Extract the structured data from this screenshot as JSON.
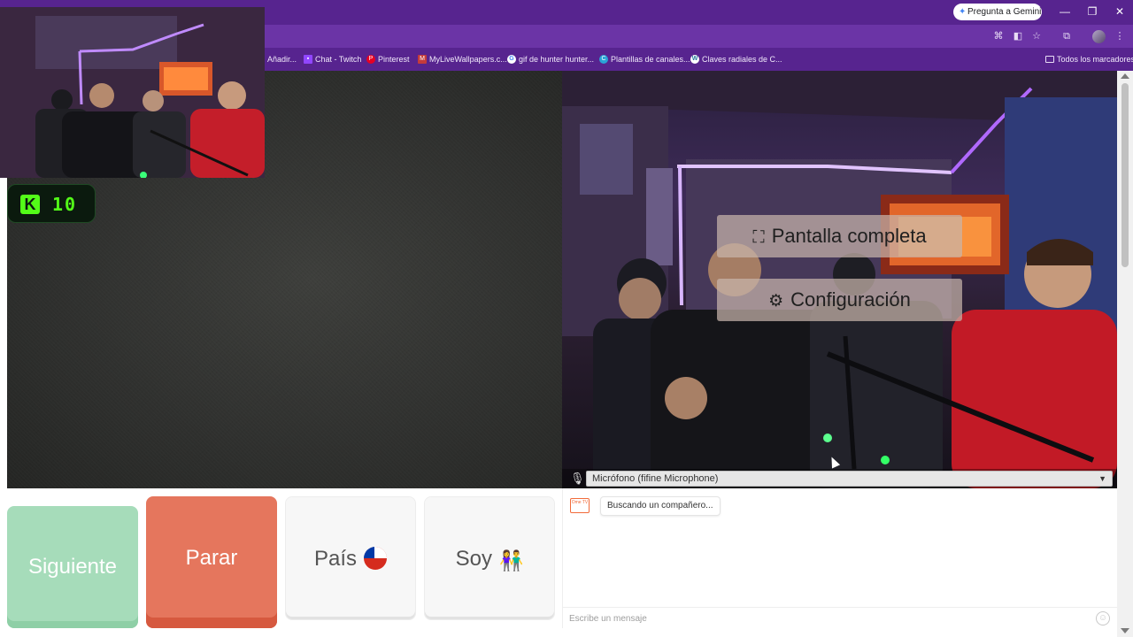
{
  "browser": {
    "gemini_button": "Pregunta a Gemini",
    "bookmarks": [
      {
        "label": "Añadir...",
        "icon": "folder-icon"
      },
      {
        "label": "Chat - Twitch",
        "icon": "twitch-icon"
      },
      {
        "label": "Pinterest",
        "icon": "pinterest-icon"
      },
      {
        "label": "MyLiveWallpapers.c...",
        "icon": "site-icon"
      },
      {
        "label": "gif de hunter hunter...",
        "icon": "google-icon"
      },
      {
        "label": "Plantillas de canales...",
        "icon": "site-icon"
      },
      {
        "label": "Claves radiales de C...",
        "icon": "wordpress-icon"
      }
    ],
    "all_bookmarks": "Todos los marcadores"
  },
  "overlay": {
    "kick_count": "10"
  },
  "video_menu": {
    "fullscreen": "Pantalla completa",
    "settings": "Configuración"
  },
  "microphone": {
    "selected": "Micrófono (fifine Microphone)"
  },
  "controls": {
    "next": "Siguiente",
    "stop": "Parar",
    "country": "País",
    "soy": "Soy"
  },
  "chat": {
    "logo_text": "Ome TV",
    "status_message": "Buscando un compañero...",
    "placeholder": "Escribe un mensaje"
  },
  "colors": {
    "browser_purple": "#57248f",
    "next_green": "#a6dcba",
    "stop_red": "#e5765d",
    "kick_green": "#53fc18"
  }
}
